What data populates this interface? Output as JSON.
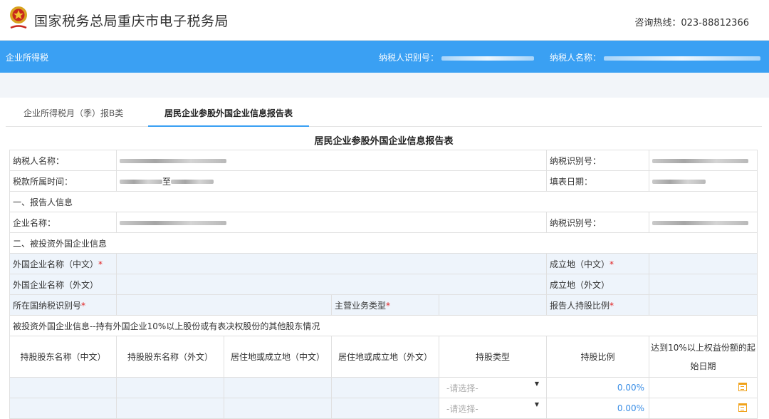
{
  "header": {
    "title": "国家税务总局重庆市电子税务局",
    "hotline": "咨询热线：023-88812366"
  },
  "bluebar": {
    "module": "企业所得税",
    "taxpayer_id_label": "纳税人识别号：",
    "taxpayer_name_label": "纳税人名称："
  },
  "tabs": [
    {
      "label": "企业所得税月（季）报B类"
    },
    {
      "label": "居民企业参股外国企业信息报告表"
    }
  ],
  "form": {
    "title": "居民企业参股外国企业信息报告表",
    "taxpayer_name_label": "纳税人名称：",
    "tax_id_label": "纳税识别号：",
    "period_label": "税款所属时间：",
    "period_to": "至",
    "fill_date_label": "填表日期：",
    "section1": "一、报告人信息",
    "company_name_label": "企业名称：",
    "section2": "二、被投资外国企业信息",
    "foreign_name_cn": "外国企业名称（中文）",
    "foreign_name_en": "外国企业名称（外文）",
    "established_cn": "成立地（中文）",
    "established_en": "成立地（外文）",
    "country_tax_id": "所在国纳税识别号",
    "main_business": "主营业务类型",
    "share_ratio": "报告人持股比例",
    "shareholders_section": "被投资外国企业信息--持有外国企业10%以上股份或有表决权股份的其他股东情况",
    "columns": [
      "持股股东名称（中文）",
      "持股股东名称（外文）",
      "居住地或成立地（中文）",
      "居住地或成立地（外文）",
      "持股类型",
      "持股比例",
      "达到10%以上权益份额的起始日期"
    ],
    "rows": [
      {
        "type_placeholder": "-请选择-",
        "ratio": "0.00%"
      },
      {
        "type_placeholder": "-请选择-",
        "ratio": "0.00%"
      }
    ]
  },
  "colors": {
    "accent": "#3aa0f3",
    "required": "#e02020",
    "input_bg": "#eef4fb"
  },
  "icons": [
    "tax-emblem-icon",
    "calendar-icon",
    "caret-down-icon"
  ]
}
